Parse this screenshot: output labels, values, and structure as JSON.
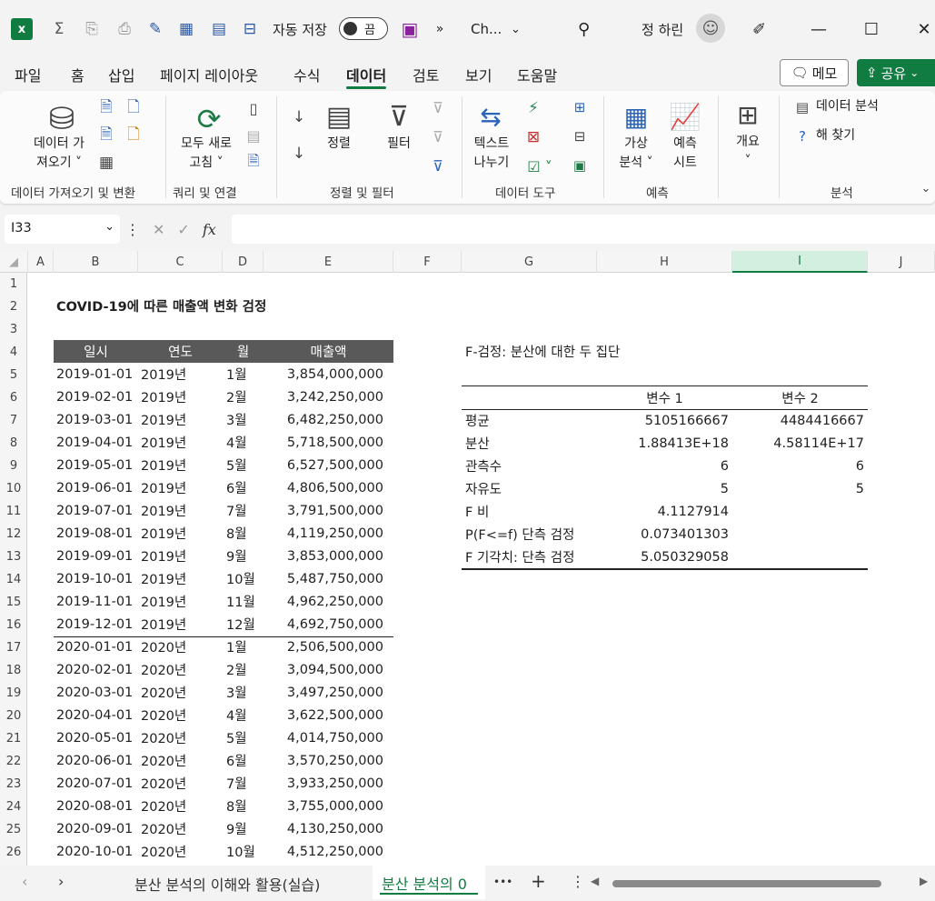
{
  "titlebar": {
    "autosave_label": "자동 저장",
    "autosave_state": "끔",
    "overflow": "»",
    "filename": "Ch...",
    "user_name": "정 하린"
  },
  "menu": {
    "tabs": [
      "파일",
      "홈",
      "삽입",
      "페이지 레이아웃",
      "수식",
      "데이터",
      "검토",
      "보기",
      "도움말"
    ],
    "active_tab": "데이터",
    "memo": "메모",
    "share": "공유"
  },
  "ribbon": {
    "get_data": [
      "데이터 가",
      "져오기 ˅"
    ],
    "refresh_all": [
      "모두 새로",
      "고침 ˅"
    ],
    "sort": "정렬",
    "filter": "필터",
    "text_to_columns": [
      "텍스트",
      "나누기"
    ],
    "what_if": [
      "가상",
      "분석 ˅"
    ],
    "forecast_sheet": [
      "예측",
      "시트"
    ],
    "outline": "개요",
    "outline_caret": "˅",
    "data_analysis": "데이터 분석",
    "solver": "해 찾기",
    "groups": [
      "데이터 가져오기 및 변환",
      "쿼리 및 연결",
      "정렬 및 필터",
      "데이터 도구",
      "예측",
      "분석"
    ]
  },
  "formula_bar": {
    "name_box": "I33",
    "formula": ""
  },
  "columns": [
    "A",
    "B",
    "C",
    "D",
    "E",
    "F",
    "G",
    "H",
    "I",
    "J"
  ],
  "selected_column": "I",
  "rows": [
    "1",
    "2",
    "3",
    "4",
    "5",
    "6",
    "7",
    "8",
    "9",
    "10",
    "11",
    "12",
    "13",
    "14",
    "15",
    "16",
    "17",
    "18",
    "19",
    "20",
    "21",
    "22",
    "23",
    "24",
    "25",
    "26"
  ],
  "sheet": {
    "title": "COVID-19에 따른 매출액 변화 검정",
    "table_headers": [
      "일시",
      "연도",
      "월",
      "매출액"
    ],
    "table_rows": [
      [
        "2019-01-01",
        "2019년",
        "1월",
        "3,854,000,000"
      ],
      [
        "2019-02-01",
        "2019년",
        "2월",
        "3,242,250,000"
      ],
      [
        "2019-03-01",
        "2019년",
        "3월",
        "6,482,250,000"
      ],
      [
        "2019-04-01",
        "2019년",
        "4월",
        "5,718,500,000"
      ],
      [
        "2019-05-01",
        "2019년",
        "5월",
        "6,527,500,000"
      ],
      [
        "2019-06-01",
        "2019년",
        "6월",
        "4,806,500,000"
      ],
      [
        "2019-07-01",
        "2019년",
        "7월",
        "3,791,500,000"
      ],
      [
        "2019-08-01",
        "2019년",
        "8월",
        "4,119,250,000"
      ],
      [
        "2019-09-01",
        "2019년",
        "9월",
        "3,853,000,000"
      ],
      [
        "2019-10-01",
        "2019년",
        "10월",
        "5,487,750,000"
      ],
      [
        "2019-11-01",
        "2019년",
        "11월",
        "4,962,250,000"
      ],
      [
        "2019-12-01",
        "2019년",
        "12월",
        "4,692,750,000"
      ],
      [
        "2020-01-01",
        "2020년",
        "1월",
        "2,506,500,000"
      ],
      [
        "2020-02-01",
        "2020년",
        "2월",
        "3,094,500,000"
      ],
      [
        "2020-03-01",
        "2020년",
        "3월",
        "3,497,250,000"
      ],
      [
        "2020-04-01",
        "2020년",
        "4월",
        "3,622,500,000"
      ],
      [
        "2020-05-01",
        "2020년",
        "5월",
        "4,014,750,000"
      ],
      [
        "2020-06-01",
        "2020년",
        "6월",
        "3,570,250,000"
      ],
      [
        "2020-07-01",
        "2020년",
        "7월",
        "3,933,250,000"
      ],
      [
        "2020-08-01",
        "2020년",
        "8월",
        "3,755,000,000"
      ],
      [
        "2020-09-01",
        "2020년",
        "9월",
        "4,130,250,000"
      ],
      [
        "2020-10-01",
        "2020년",
        "10월",
        "4,512,250,000"
      ]
    ],
    "ftest": {
      "title": "F-검정: 분산에 대한 두 집단",
      "headers": [
        "",
        "변수 1",
        "변수 2"
      ],
      "rows": [
        [
          "평균",
          "5105166667",
          "4484416667"
        ],
        [
          "분산",
          "1.88413E+18",
          "4.58114E+17"
        ],
        [
          "관측수",
          "6",
          "6"
        ],
        [
          "자유도",
          "5",
          "5"
        ],
        [
          "F 비",
          "4.1127914",
          ""
        ],
        [
          "P(F<=f) 단측 검정",
          "0.073401303",
          ""
        ],
        [
          "F 기각치: 단측 검정",
          "5.050329058",
          ""
        ]
      ]
    }
  },
  "sheet_tabs": {
    "tab1": "분산 분석의 이해와 활용(실습)",
    "tab2": "분산 분석의 0",
    "more": "•••",
    "add": "+"
  },
  "colors": {
    "accent": "#107c41",
    "table_header": "#595959"
  }
}
